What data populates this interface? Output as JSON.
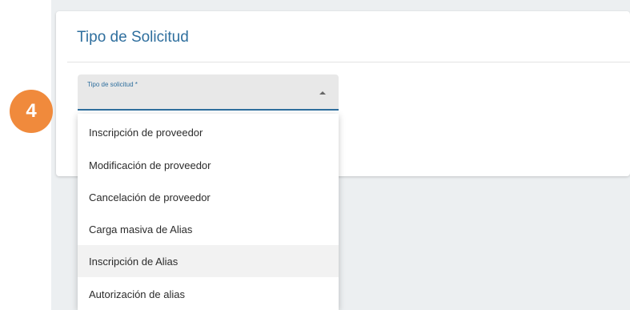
{
  "card": {
    "title": "Tipo de Solicitud"
  },
  "select": {
    "label": "Tipo de solicitud *"
  },
  "dropdown": {
    "options": [
      "Inscripción de proveedor",
      "Modificación de proveedor",
      "Cancelación de proveedor",
      "Carga masiva de Alias",
      "Inscripción de Alias",
      "Autorización de alias"
    ],
    "highlighted_index": 4
  },
  "badge": {
    "number": "4"
  },
  "colors": {
    "accent": "#2f6f9e",
    "badge": "#f08a3c",
    "page_background": "#eceff1",
    "highlight": "#f2f2f2"
  }
}
